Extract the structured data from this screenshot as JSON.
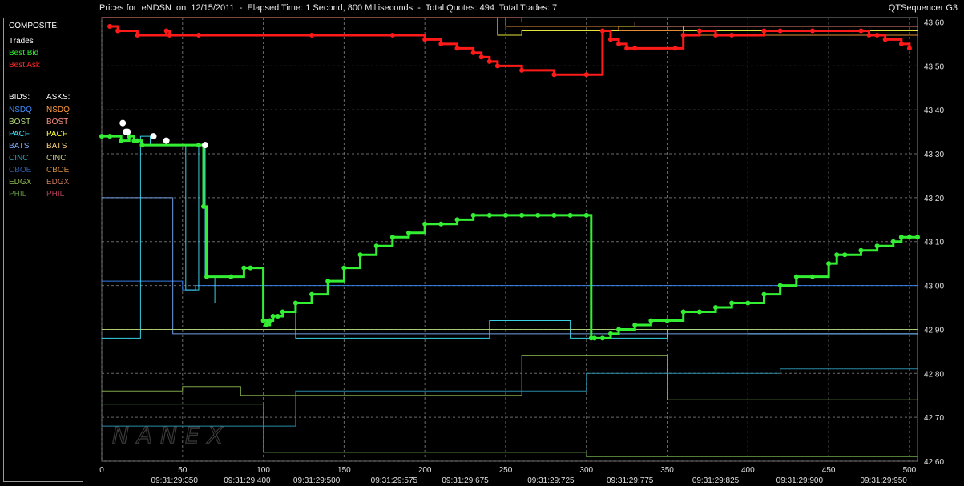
{
  "header": {
    "title": "Prices for  eNDSN  on  12/15/2011  -  Elapsed Time: 1 Second, 800 Milliseconds  -  Total Quotes: 494  Total Trades: 7",
    "brand": "QTSequencer G3"
  },
  "legend": {
    "composite_label": "COMPOSITE:",
    "trades_label": "Trades",
    "best_bid_label": "Best Bid",
    "best_ask_label": "Best Ask",
    "bids_label": "BIDS:",
    "asks_label": "ASKS:",
    "exchanges": [
      {
        "bid": "NSDQ",
        "ask": "NSDQ",
        "bid_color": "#3c8cff",
        "ask_color": "#ff9a3c"
      },
      {
        "bid": "BOST",
        "ask": "BOST",
        "bid_color": "#b6d97a",
        "ask_color": "#ff9080"
      },
      {
        "bid": "PACF",
        "ask": "PACF",
        "bid_color": "#40e6ff",
        "ask_color": "#ffff40"
      },
      {
        "bid": "BATS",
        "ask": "BATS",
        "bid_color": "#80b0ff",
        "ask_color": "#ffd27a"
      },
      {
        "bid": "CINC",
        "ask": "CINC",
        "bid_color": "#2e9ab8",
        "ask_color": "#c9c98a"
      },
      {
        "bid": "CBOE",
        "ask": "CBOE",
        "bid_color": "#2d5aa0",
        "ask_color": "#d28a3c"
      },
      {
        "bid": "EDGX",
        "ask": "EDGX",
        "bid_color": "#8cb850",
        "ask_color": "#c87a5a"
      },
      {
        "bid": "PHIL",
        "ask": "PHIL",
        "bid_color": "#5a8c3c",
        "ask_color": "#b03c5a"
      }
    ]
  },
  "watermark": "NANEX",
  "chart_data": {
    "type": "line",
    "xlim": [
      0,
      505
    ],
    "ylim": [
      42.6,
      43.61
    ],
    "x_ticks": [
      0,
      50,
      100,
      150,
      200,
      250,
      300,
      350,
      400,
      450,
      500
    ],
    "y_ticks": [
      42.6,
      42.7,
      42.8,
      42.9,
      43.0,
      43.1,
      43.2,
      43.3,
      43.4,
      43.5,
      43.6
    ],
    "y_tick_labels": [
      "42.60",
      "42.70",
      "42.80",
      "42.90",
      "43.00",
      "43.10",
      "43.20",
      "43.30",
      "43.40",
      "43.50",
      "43.60"
    ],
    "time_labels": [
      {
        "x": 45,
        "label": "09:31:29:350"
      },
      {
        "x": 90,
        "label": "09:31:29:400"
      },
      {
        "x": 133,
        "label": "09:31:29:500"
      },
      {
        "x": 181,
        "label": "09:31:29:575"
      },
      {
        "x": 225,
        "label": "09:31:29:675"
      },
      {
        "x": 278,
        "label": "09:31:29:725"
      },
      {
        "x": 327,
        "label": "09:31:29:775"
      },
      {
        "x": 380,
        "label": "09:31:29:825"
      },
      {
        "x": 432,
        "label": "09:31:29:900"
      },
      {
        "x": 484,
        "label": "09:31:29:950"
      }
    ],
    "grid": true,
    "series": [
      {
        "name": "Best Ask",
        "color": "#ff1a1a",
        "x": [
          5,
          10,
          22,
          40,
          42,
          60,
          130,
          180,
          200,
          210,
          220,
          230,
          235,
          240,
          245,
          260,
          280,
          300,
          310,
          315,
          320,
          325,
          330,
          355,
          360,
          370,
          380,
          390,
          410,
          420,
          440,
          470,
          475,
          480,
          485,
          495,
          500
        ],
        "y": [
          43.59,
          43.58,
          43.57,
          43.58,
          43.57,
          43.57,
          43.57,
          43.57,
          43.56,
          43.55,
          43.54,
          43.53,
          43.52,
          43.51,
          43.5,
          43.49,
          43.48,
          43.48,
          43.58,
          43.56,
          43.55,
          43.54,
          43.54,
          43.54,
          43.57,
          43.58,
          43.57,
          43.57,
          43.58,
          43.58,
          43.58,
          43.58,
          43.57,
          43.57,
          43.56,
          43.55,
          43.54
        ]
      },
      {
        "name": "Best Bid",
        "color": "#33ee33",
        "x": [
          0,
          5,
          12,
          17,
          20,
          22,
          25,
          60,
          63,
          65,
          80,
          88,
          92,
          100,
          102,
          104,
          106,
          109,
          112,
          120,
          130,
          140,
          150,
          160,
          170,
          180,
          190,
          200,
          210,
          220,
          230,
          240,
          250,
          260,
          270,
          280,
          290,
          300,
          303,
          305,
          310,
          315,
          320,
          330,
          340,
          350,
          360,
          370,
          380,
          390,
          400,
          410,
          420,
          430,
          440,
          450,
          455,
          460,
          470,
          480,
          490,
          495,
          500,
          505
        ],
        "y": [
          43.34,
          43.34,
          43.33,
          43.34,
          43.33,
          43.33,
          43.32,
          43.32,
          43.18,
          43.02,
          43.02,
          43.04,
          43.04,
          42.92,
          42.91,
          42.92,
          42.93,
          42.93,
          42.94,
          42.96,
          42.98,
          43.01,
          43.04,
          43.07,
          43.09,
          43.11,
          43.12,
          43.14,
          43.14,
          43.15,
          43.16,
          43.16,
          43.16,
          43.16,
          43.16,
          43.16,
          43.16,
          43.16,
          42.88,
          42.88,
          42.88,
          42.89,
          42.9,
          42.91,
          42.92,
          42.92,
          42.94,
          42.94,
          42.95,
          42.96,
          42.96,
          42.98,
          43.0,
          43.02,
          43.02,
          43.05,
          43.07,
          43.07,
          43.08,
          43.09,
          43.1,
          43.11,
          43.11,
          43.11
        ]
      },
      {
        "name": "Trades",
        "color": "#ffffff",
        "x": [
          13,
          15,
          16,
          32,
          40,
          64
        ],
        "y": [
          43.37,
          43.35,
          43.35,
          43.34,
          43.33,
          43.32
        ]
      }
    ],
    "bid_steps": [
      {
        "color": "#3c8cff",
        "x": [
          0,
          30,
          50,
          58,
          64,
          505
        ],
        "y": [
          43.01,
          43.01,
          42.99,
          43.0,
          43.0,
          43.0
        ]
      },
      {
        "color": "#40e6ff",
        "x": [
          0,
          24,
          30,
          40,
          52,
          60,
          64,
          70,
          120,
          200,
          240,
          260,
          290,
          330,
          350,
          400,
          505
        ],
        "y": [
          42.88,
          43.34,
          43.32,
          43.32,
          42.99,
          43.32,
          43.02,
          42.96,
          42.88,
          42.88,
          42.92,
          42.92,
          42.88,
          42.88,
          42.9,
          42.89,
          42.89
        ]
      },
      {
        "color": "#80b0ff",
        "x": [
          0,
          30,
          44,
          60,
          505
        ],
        "y": [
          43.2,
          43.2,
          42.89,
          42.89,
          42.89
        ]
      },
      {
        "color": "#b6d97a",
        "x": [
          0,
          60,
          100,
          505
        ],
        "y": [
          42.9,
          42.9,
          42.9,
          42.9
        ]
      },
      {
        "color": "#8cb850",
        "x": [
          0,
          50,
          86,
          200,
          260,
          350,
          400,
          505
        ],
        "y": [
          42.76,
          42.77,
          42.75,
          42.75,
          42.84,
          42.74,
          42.74,
          42.76
        ]
      },
      {
        "color": "#5a8c3c",
        "x": [
          0,
          70,
          100,
          200,
          300,
          360,
          505
        ],
        "y": [
          42.73,
          42.73,
          42.62,
          42.62,
          42.61,
          42.61,
          42.7
        ]
      },
      {
        "color": "#2e9ab8",
        "x": [
          0,
          90,
          120,
          260,
          300,
          380,
          420,
          505
        ],
        "y": [
          42.68,
          42.68,
          42.76,
          42.76,
          42.8,
          42.8,
          42.81,
          42.79
        ]
      }
    ],
    "ask_steps": [
      {
        "color": "#ffff40",
        "x": [
          0,
          245,
          260,
          300,
          320,
          360,
          505
        ],
        "y": [
          43.61,
          43.57,
          43.58,
          43.58,
          43.59,
          43.58,
          43.58
        ]
      },
      {
        "color": "#ff9a3c",
        "x": [
          0,
          250,
          300,
          320,
          360,
          505
        ],
        "y": [
          43.61,
          43.59,
          43.59,
          43.58,
          43.57,
          43.57
        ]
      },
      {
        "color": "#ff9080",
        "x": [
          0,
          260,
          330,
          505
        ],
        "y": [
          43.61,
          43.6,
          43.59,
          43.59
        ]
      }
    ]
  }
}
